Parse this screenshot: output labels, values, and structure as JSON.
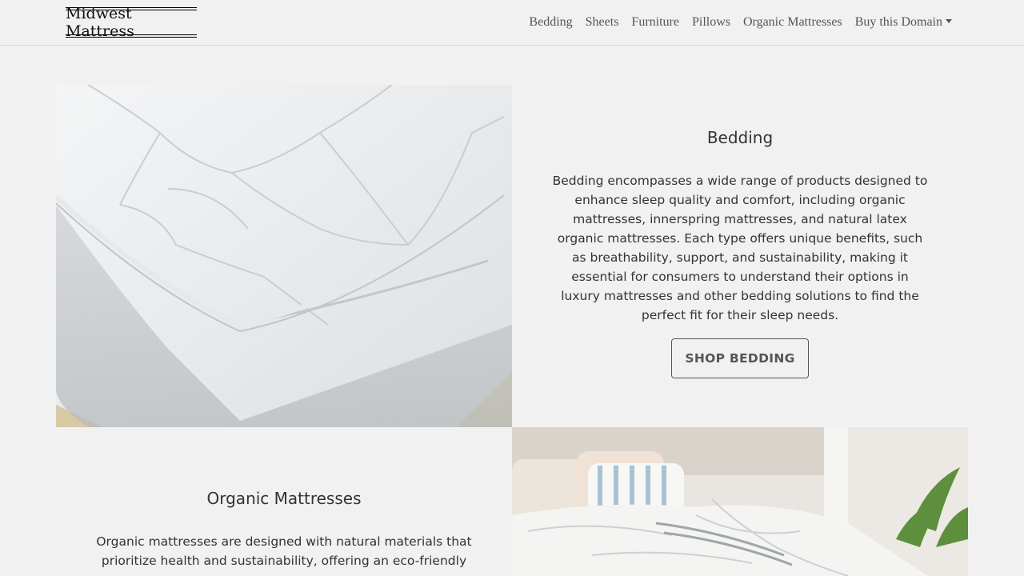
{
  "brand": "Midwest Mattress",
  "nav": {
    "items": [
      "Bedding",
      "Sheets",
      "Furniture",
      "Pillows",
      "Organic Mattresses"
    ],
    "dropdown": "Buy this Domain"
  },
  "sections": [
    {
      "title": "Bedding",
      "body": "Bedding encompasses a wide range of products designed to enhance sleep quality and comfort, including organic mattresses, innerspring mattresses, and natural latex organic mattresses. Each type offers unique benefits, such as breathability, support, and sustainability, making it essential for consumers to understand their options in luxury mattresses and other bedding solutions to find the perfect fit for their sleep needs.",
      "button": "SHOP BEDDING"
    },
    {
      "title": "Organic Mattresses",
      "body": "Organic mattresses are designed with natural materials that prioritize health and sustainability, offering an eco-friendly"
    }
  ]
}
